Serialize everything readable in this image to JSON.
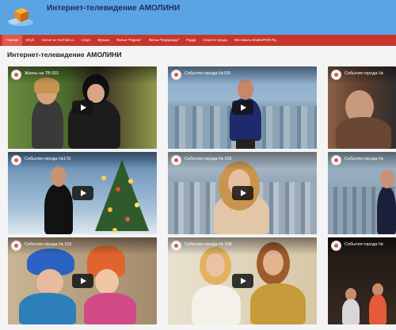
{
  "header": {
    "title": "Интернет-телевидение АМОЛИНИ",
    "logo_icon": "tv-cube-logo-icon",
    "bg_color": "#5aa4e3"
  },
  "nav": {
    "bg_color": "#c8352b",
    "items": [
      {
        "label": "Главная",
        "active": true
      },
      {
        "label": "Ютуб"
      },
      {
        "label": "Скачат из YouTube.ru"
      },
      {
        "label": "Спорт"
      },
      {
        "label": "Музыка"
      },
      {
        "label": "Фильм \"Родина\""
      },
      {
        "label": "Фильм \"Водоравда\""
      },
      {
        "label": "Радар"
      },
      {
        "label": "Новости города"
      },
      {
        "label": "Фестиваль БАШКИРИЯ.РЦ"
      }
    ]
  },
  "main": {
    "page_title": "Интернет-телевидение АМОЛИНИ",
    "videos": [
      {
        "title": "Жизнь на ТВ 001",
        "channel_icon": "channel-avatar-icon"
      },
      {
        "title": "События города №100",
        "channel_icon": "channel-avatar-icon"
      },
      {
        "title": "События города №",
        "channel_icon": "channel-avatar-icon"
      },
      {
        "title": "События города №176",
        "channel_icon": "channel-avatar-icon"
      },
      {
        "title": "События города № 105",
        "channel_icon": "channel-avatar-icon"
      },
      {
        "title": "События города №",
        "channel_icon": "channel-avatar-icon"
      },
      {
        "title": "События города № 101",
        "channel_icon": "channel-avatar-icon"
      },
      {
        "title": "События города № 108",
        "channel_icon": "channel-avatar-icon"
      },
      {
        "title": "События города №",
        "channel_icon": "channel-avatar-icon"
      }
    ]
  }
}
